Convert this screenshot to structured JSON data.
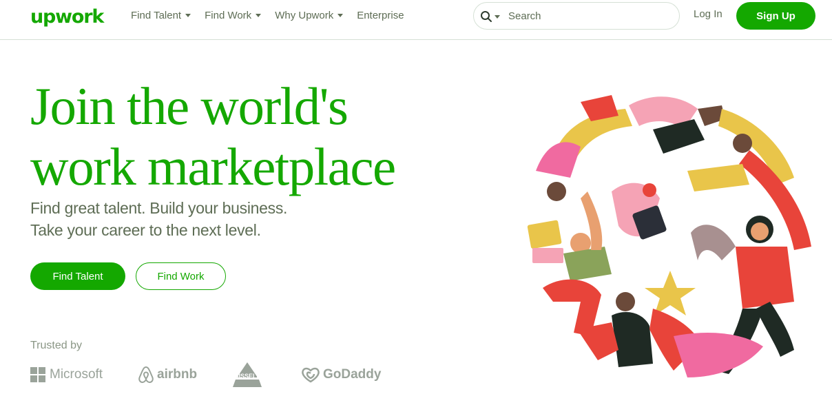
{
  "header": {
    "logo": "upwork",
    "nav": [
      {
        "label": "Find Talent",
        "has_dropdown": true
      },
      {
        "label": "Find Work",
        "has_dropdown": true
      },
      {
        "label": "Why Upwork",
        "has_dropdown": true
      },
      {
        "label": "Enterprise",
        "has_dropdown": false
      }
    ],
    "search": {
      "placeholder": "Search",
      "value": ""
    },
    "login_label": "Log In",
    "signup_label": "Sign Up"
  },
  "hero": {
    "headline_line1": "Join the world's",
    "headline_line2": "work marketplace",
    "sub_line1": "Find great talent. Build your business.",
    "sub_line2": "Take your career to the next level.",
    "primary_button": "Find Talent",
    "secondary_button": "Find Work"
  },
  "trusted": {
    "label": "Trusted by",
    "brands": [
      "Microsoft",
      "airbnb",
      "BISSELL",
      "GoDaddy"
    ]
  },
  "colors": {
    "brand_green": "#14a800",
    "text_gray": "#5e6d55",
    "logo_gray": "#9aa39a",
    "border": "#d5e0d5"
  },
  "icons": {
    "search": "search-icon",
    "dropdown": "chevron-down-icon"
  }
}
